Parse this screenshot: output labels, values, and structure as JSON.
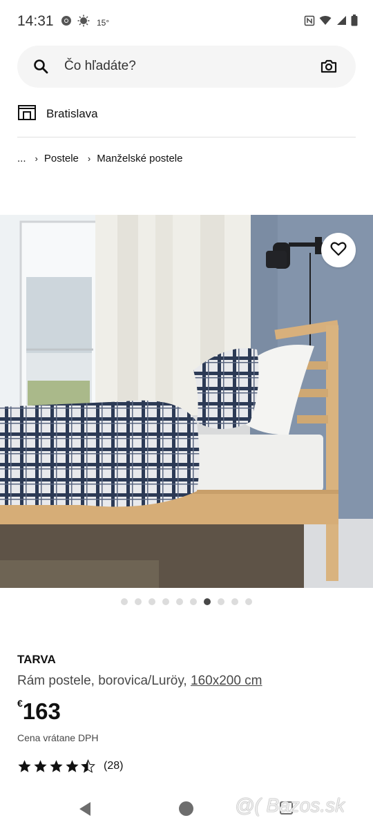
{
  "status_bar": {
    "time": "14:31",
    "temperature": "15°",
    "icons": [
      "chrome-icon",
      "weather-icon",
      "nfc-icon",
      "wifi-icon",
      "signal-icon",
      "battery-icon"
    ]
  },
  "search": {
    "placeholder": "Čo hľadáte?"
  },
  "store": {
    "name": "Bratislava"
  },
  "breadcrumb": {
    "items": [
      "...",
      "Postele",
      "Manželské postele"
    ]
  },
  "gallery": {
    "slide_count": 10,
    "active_slide": 7
  },
  "product": {
    "brand": "TARVA",
    "description": "Rám postele, borovica/Luröy,",
    "size": "160x200 cm",
    "currency": "€",
    "price": "163",
    "price_note": "Cena vrátane DPH",
    "rating": 4.5,
    "rating_max": 5,
    "review_count": "(28)"
  },
  "watermark": "@( Bazos.sk"
}
